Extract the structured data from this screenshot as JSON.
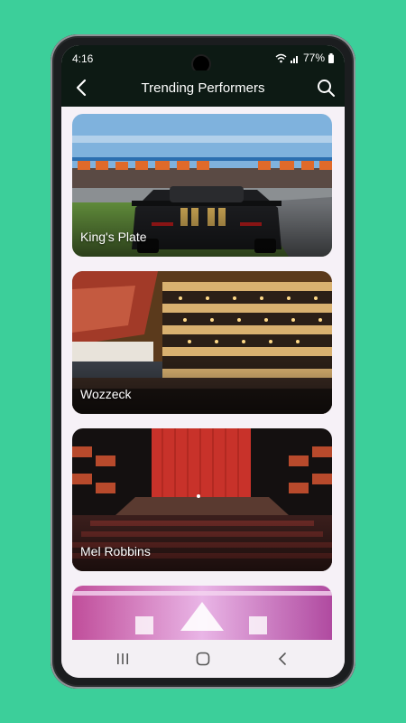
{
  "status": {
    "time": "4:16",
    "battery": "77%"
  },
  "appbar": {
    "title": "Trending Performers"
  },
  "performers": [
    {
      "name": "King's Plate"
    },
    {
      "name": "Wozzeck"
    },
    {
      "name": "Mel Robbins"
    },
    {
      "name": ""
    }
  ],
  "colors": {
    "background": "#3ccf9a",
    "appbar": "#0d1a14",
    "screen": "#f6f1f7"
  },
  "icons": [
    "back-arrow-icon",
    "search-icon",
    "wifi-icon",
    "signal-icon",
    "battery-icon",
    "recents-icon",
    "home-icon",
    "nav-back-icon"
  ]
}
